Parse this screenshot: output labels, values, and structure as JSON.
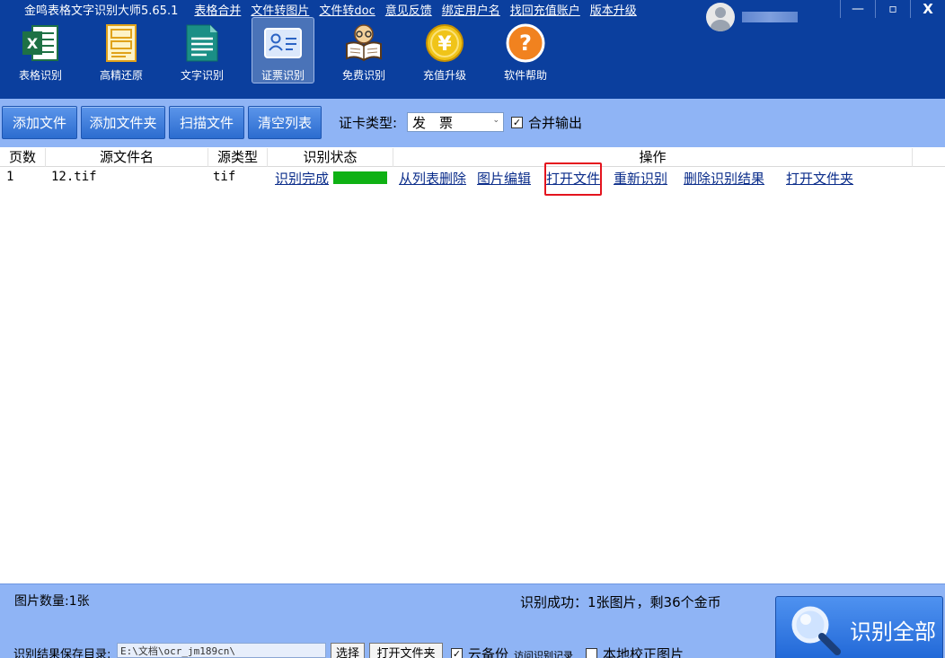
{
  "titlebar": {
    "app_title": "金鸣表格文字识别大师5.65.1",
    "links": [
      "表格合并",
      "文件转图片",
      "文件转doc",
      "意见反馈",
      "绑定用户名",
      "找回充值账户",
      "版本升级"
    ]
  },
  "window_controls": {
    "minimize": "—",
    "maximize": "▫",
    "close": "X"
  },
  "toolbar": [
    {
      "label": "表格识别",
      "icon": "excel-icon"
    },
    {
      "label": "高精还原",
      "icon": "document-layout-icon"
    },
    {
      "label": "文字识别",
      "icon": "text-document-icon"
    },
    {
      "label": "证票识别",
      "icon": "id-card-icon",
      "active": true
    },
    {
      "label": "免费识别",
      "icon": "reading-book-icon"
    },
    {
      "label": "充值升级",
      "icon": "yen-coin-icon"
    },
    {
      "label": "软件帮助",
      "icon": "help-icon"
    }
  ],
  "actions": {
    "add_file": "添加文件",
    "add_folder": "添加文件夹",
    "scan_file": "扫描文件",
    "clear_list": "清空列表",
    "card_type_label": "证卡类型:",
    "card_type_value": "发　票",
    "merge_output": "合并输出",
    "merge_checked": true
  },
  "table": {
    "headers": [
      "页数",
      "源文件名",
      "源类型",
      "识别状态",
      "操作"
    ],
    "rows": [
      {
        "page": "1",
        "filename": "12.tif",
        "type": "tif",
        "status": "识别完成",
        "progress": 1.0,
        "ops": [
          "从列表删除",
          "图片编辑",
          "打开文件",
          "重新识别",
          "删除识别结果",
          "打开文件夹"
        ]
      }
    ]
  },
  "footer": {
    "image_count": "图片数量:1张",
    "result_summary": "识别成功：1张图片，剩36个金币",
    "save_dir_label": "识别结果保存目录:",
    "save_dir_value": "E:\\文档\\ocr_jm189cn\\",
    "choose_button": "选择",
    "open_folder_button": "打开文件夹",
    "cloud_backup": "云备份",
    "visit_records": "访问识别记录",
    "local_correct": "本地校正图片",
    "recognize_all": "识别全部"
  },
  "colors": {
    "header_bg": "#0b3f9e",
    "bar_bg": "#8fb4f5",
    "progress": "#0fb114",
    "highlight": "#e4141e",
    "link": "#0a2c8a"
  }
}
